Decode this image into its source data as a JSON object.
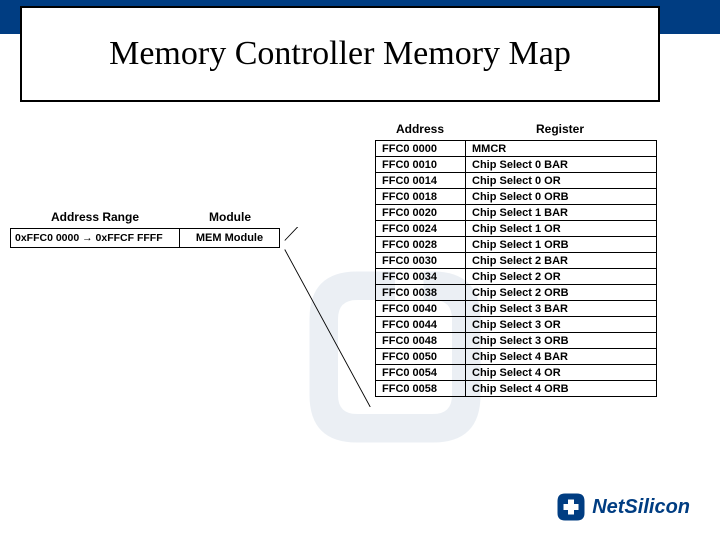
{
  "title": "Memory Controller Memory Map",
  "left": {
    "header_range": "Address Range",
    "header_module": "Module",
    "rows": [
      {
        "range": "0xFFC0 0000 → 0xFFCF FFFF",
        "module": "MEM Module"
      }
    ]
  },
  "right": {
    "header_addr": "Address",
    "header_reg": "Register",
    "rows": [
      {
        "addr": "FFC0 0000",
        "reg": "MMCR"
      },
      {
        "addr": "FFC0 0010",
        "reg": "Chip Select 0 BAR"
      },
      {
        "addr": "FFC0 0014",
        "reg": "Chip Select 0 OR"
      },
      {
        "addr": "FFC0 0018",
        "reg": "Chip Select 0 ORB"
      },
      {
        "addr": "FFC0 0020",
        "reg": "Chip Select 1 BAR"
      },
      {
        "addr": "FFC0 0024",
        "reg": "Chip Select 1 OR"
      },
      {
        "addr": "FFC0 0028",
        "reg": "Chip Select 1 ORB"
      },
      {
        "addr": "FFC0 0030",
        "reg": "Chip Select 2 BAR"
      },
      {
        "addr": "FFC0 0034",
        "reg": "Chip Select 2 OR"
      },
      {
        "addr": "FFC0 0038",
        "reg": "Chip Select 2 ORB"
      },
      {
        "addr": "FFC0 0040",
        "reg": "Chip Select 3 BAR"
      },
      {
        "addr": "FFC0 0044",
        "reg": "Chip Select 3 OR"
      },
      {
        "addr": "FFC0 0048",
        "reg": "Chip Select 3 ORB"
      },
      {
        "addr": "FFC0 0050",
        "reg": "Chip Select 4 BAR"
      },
      {
        "addr": "FFC0 0054",
        "reg": "Chip Select 4 OR"
      },
      {
        "addr": "FFC0 0058",
        "reg": "Chip Select 4 ORB"
      }
    ]
  },
  "logo": {
    "brand": "NetSilicon"
  }
}
